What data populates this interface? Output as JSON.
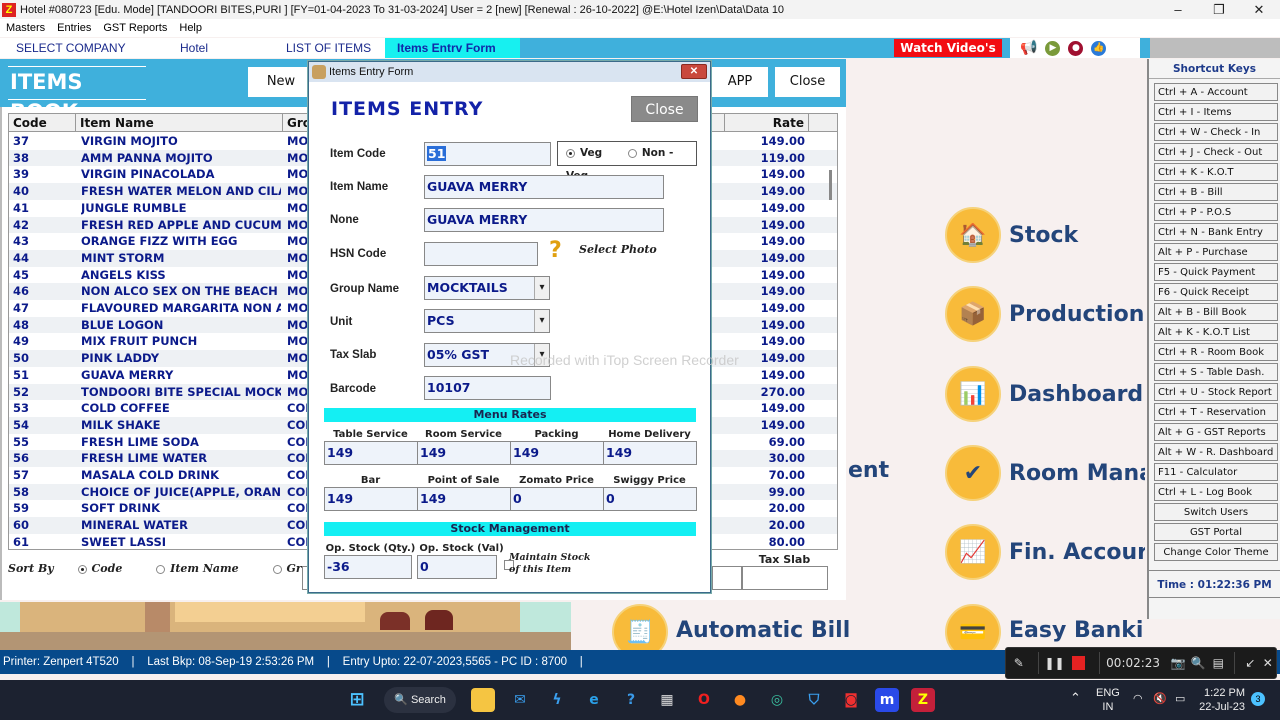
{
  "window": {
    "title": "Hotel #080723 [Edu. Mode] [TANDOORI BITES,PURI ] [FY=01-04-2023 To 31-03-2024] User =  2 [new]  [Renewal : 26-10-2022] @E:\\Hotel Izen\\Data\\Data 10",
    "minimize": "–",
    "maximize": "❐",
    "close": "✕"
  },
  "menu": [
    "Masters",
    "Entries",
    "GST Reports",
    "Help"
  ],
  "nav": {
    "tabs": [
      "SELECT COMPANY",
      "Hotel",
      "LIST OF ITEMS",
      "Items Entrv Form"
    ],
    "watch_videos": "Watch Video's",
    "icons": [
      "megaphone-icon",
      "video-call-icon",
      "chat-icon",
      "thumbs-up-icon"
    ]
  },
  "items_book": {
    "title": "ITEMS BOOK",
    "buttons": {
      "new": "New",
      "app": "APP",
      "close": "Close"
    },
    "columns": [
      "Code",
      "Item Name",
      "Gro",
      "Rate"
    ],
    "rows": [
      {
        "code": "37",
        "name": "VIRGIN MOJITO",
        "group": "MO",
        "rate": "149.00"
      },
      {
        "code": "38",
        "name": "AMM PANNA MOJITO",
        "group": "MO",
        "rate": "119.00"
      },
      {
        "code": "39",
        "name": "VIRGIN PINACOLADA",
        "group": "MO",
        "rate": "149.00"
      },
      {
        "code": "40",
        "name": "FRESH WATER MELON AND CILA...",
        "group": "MO",
        "rate": "149.00"
      },
      {
        "code": "41",
        "name": "JUNGLE RUMBLE",
        "group": "MO",
        "rate": "149.00"
      },
      {
        "code": "42",
        "name": "FRESH RED APPLE AND CUCUMB...",
        "group": "MO",
        "rate": "149.00"
      },
      {
        "code": "43",
        "name": "ORANGE FIZZ WITH EGG",
        "group": "MO",
        "rate": "149.00"
      },
      {
        "code": "44",
        "name": "MINT STORM",
        "group": "MO",
        "rate": "149.00"
      },
      {
        "code": "45",
        "name": "ANGELS KISS",
        "group": "MO",
        "rate": "149.00"
      },
      {
        "code": "46",
        "name": "NON ALCO SEX ON THE BEACH",
        "group": "MO",
        "rate": "149.00"
      },
      {
        "code": "47",
        "name": "FLAVOURED MARGARITA NON A...",
        "group": "MO",
        "rate": "149.00"
      },
      {
        "code": "48",
        "name": "BLUE LOGON",
        "group": "MO",
        "rate": "149.00"
      },
      {
        "code": "49",
        "name": "MIX FRUIT PUNCH",
        "group": "MO",
        "rate": "149.00"
      },
      {
        "code": "50",
        "name": "PINK LADDY",
        "group": "MO",
        "rate": "149.00"
      },
      {
        "code": "51",
        "name": "GUAVA MERRY",
        "group": "MO",
        "rate": "149.00"
      },
      {
        "code": "52",
        "name": "TONDOORI BITE SPECIAL MOCK ...",
        "group": "MO",
        "rate": "270.00"
      },
      {
        "code": "53",
        "name": "COLD COFFEE",
        "group": "COL",
        "rate": "149.00"
      },
      {
        "code": "54",
        "name": "MILK SHAKE",
        "group": "COL",
        "rate": "149.00"
      },
      {
        "code": "55",
        "name": "FRESH LIME SODA",
        "group": "COL",
        "rate": "69.00"
      },
      {
        "code": "56",
        "name": "FRESH LIME WATER",
        "group": "COL",
        "rate": "30.00"
      },
      {
        "code": "57",
        "name": "MASALA COLD DRINK",
        "group": "COL",
        "rate": "70.00"
      },
      {
        "code": "58",
        "name": "CHOICE OF JUICE(APPLE, ORANG...",
        "group": "COL",
        "rate": "99.00"
      },
      {
        "code": "59",
        "name": "SOFT DRINK",
        "group": "COL",
        "rate": "20.00"
      },
      {
        "code": "60",
        "name": "MINERAL WATER",
        "group": "COL",
        "rate": "20.00"
      },
      {
        "code": "61",
        "name": "SWEET LASSI",
        "group": "COL",
        "rate": "80.00"
      }
    ],
    "sort_by": {
      "label": "Sort By",
      "options": [
        "Code",
        "Item Name",
        "Group"
      ],
      "selected": "Code"
    },
    "tax_slab_label": "Tax Slab"
  },
  "dialog": {
    "title": "Items Entry Form",
    "heading": "ITEMS ENTRY",
    "close_label": "Close",
    "close_x": "✕",
    "labels": {
      "item_code": "Item Code",
      "item_name": "Item Name",
      "none": "None",
      "hsn": "HSN Code",
      "group": "Group Name",
      "unit": "Unit",
      "tax": "Tax Slab",
      "barcode": "Barcode"
    },
    "values": {
      "item_code": "51",
      "item_name": "GUAVA MERRY",
      "none": "GUAVA MERRY",
      "hsn": "",
      "group": "MOCKTAILS",
      "unit": "PCS",
      "tax": "05%  GST",
      "barcode": "10107"
    },
    "veg_options": [
      "Veg",
      "Non - Veg"
    ],
    "veg_selected": "Veg",
    "select_photo": "Select Photo",
    "help_icon": "?",
    "menu_rates": {
      "title": "Menu Rates",
      "row1": [
        {
          "label": "Table Service",
          "value": "149"
        },
        {
          "label": "Room Service",
          "value": "149"
        },
        {
          "label": "Packing",
          "value": "149"
        },
        {
          "label": "Home Delivery",
          "value": "149"
        }
      ],
      "row2": [
        {
          "label": "Bar",
          "value": "149"
        },
        {
          "label": "Point of Sale",
          "value": "149"
        },
        {
          "label": "Zomato Price",
          "value": "0"
        },
        {
          "label": "Swiggy Price",
          "value": "0"
        }
      ]
    },
    "stock": {
      "title": "Stock Management",
      "qty_label": "Op. Stock (Qty.)",
      "qty_value": "-36",
      "val_label": "Op. Stock (Val)",
      "val_value": "0",
      "maintain_line1": "Maintain Stock",
      "maintain_line2": "of this Item",
      "maintain_checked": false
    }
  },
  "dashboard": {
    "tiles": [
      "Stock",
      "Production",
      "Dashboard",
      "Room Mana",
      "Fin. Accour",
      "Easy Bankir",
      "Automatic Bill",
      "ent"
    ]
  },
  "shortcuts": {
    "title": "Shortcut Keys",
    "items": [
      "Ctrl + A - Account",
      "Ctrl + I - Items",
      "Ctrl + W - Check - In",
      "Ctrl + J - Check - Out",
      "Ctrl + K - K.O.T",
      "Ctrl + B - Bill",
      "Ctrl + P - P.O.S",
      "Ctrl + N - Bank Entry",
      "Alt + P - Purchase",
      "F5 - Quick Payment",
      "F6 - Quick Receipt",
      "Alt + B  -  Bill Book",
      "Alt + K  -  K.O.T List",
      "Ctrl + R - Room Book",
      "Ctrl + S - Table Dash.",
      "Ctrl + U - Stock Report",
      "Ctrl + T - Reservation",
      "Alt + G - GST Reports",
      "Alt + W - R. Dashboard",
      "F11 - Calculator",
      "Ctrl + L - Log Book"
    ],
    "buttons": [
      "Switch Users",
      "GST Portal",
      "Change Color Theme"
    ],
    "time": "Time : 01:22:36 PM"
  },
  "status": {
    "text": "Printer: Zenpert 4T520    |    Last Bkp: 08-Sep-19 2:53:26 PM    |    Entry Upto: 22-07-2023,5565 - PC ID : 8700    |"
  },
  "recorder": {
    "elapsed": "00:02:23",
    "watermark": "Recorded with iTop Screen Recorder"
  },
  "taskbar": {
    "search": "Search",
    "lang1": "ENG",
    "lang2": "IN",
    "time": "1:22 PM",
    "date": "22-Jul-23",
    "notifications": "3"
  }
}
